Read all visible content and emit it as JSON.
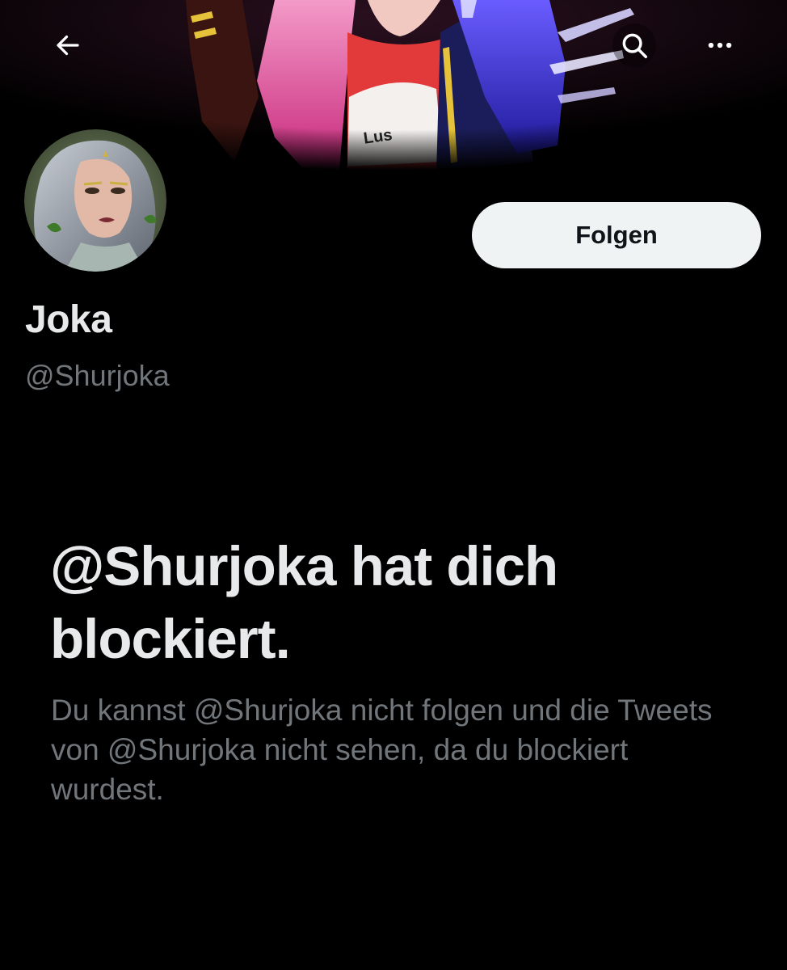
{
  "header": {
    "back_icon": "arrow-left-icon",
    "search_icon": "search-icon",
    "more_icon": "more-horizontal-icon"
  },
  "profile": {
    "display_name": "Joka",
    "handle": "@Shurjoka",
    "follow_label": "Folgen"
  },
  "blocked": {
    "title": "@Shurjoka hat dich blockiert.",
    "description": "Du kannst @Shurjoka nicht folgen und die Tweets von @Shurjoka nicht sehen, da du blockiert wurdest."
  },
  "colors": {
    "background": "#000000",
    "primary_text": "#e7e9ea",
    "secondary_text": "#71767b",
    "follow_button_bg": "#eff3f4",
    "follow_button_text": "#0f1419"
  }
}
